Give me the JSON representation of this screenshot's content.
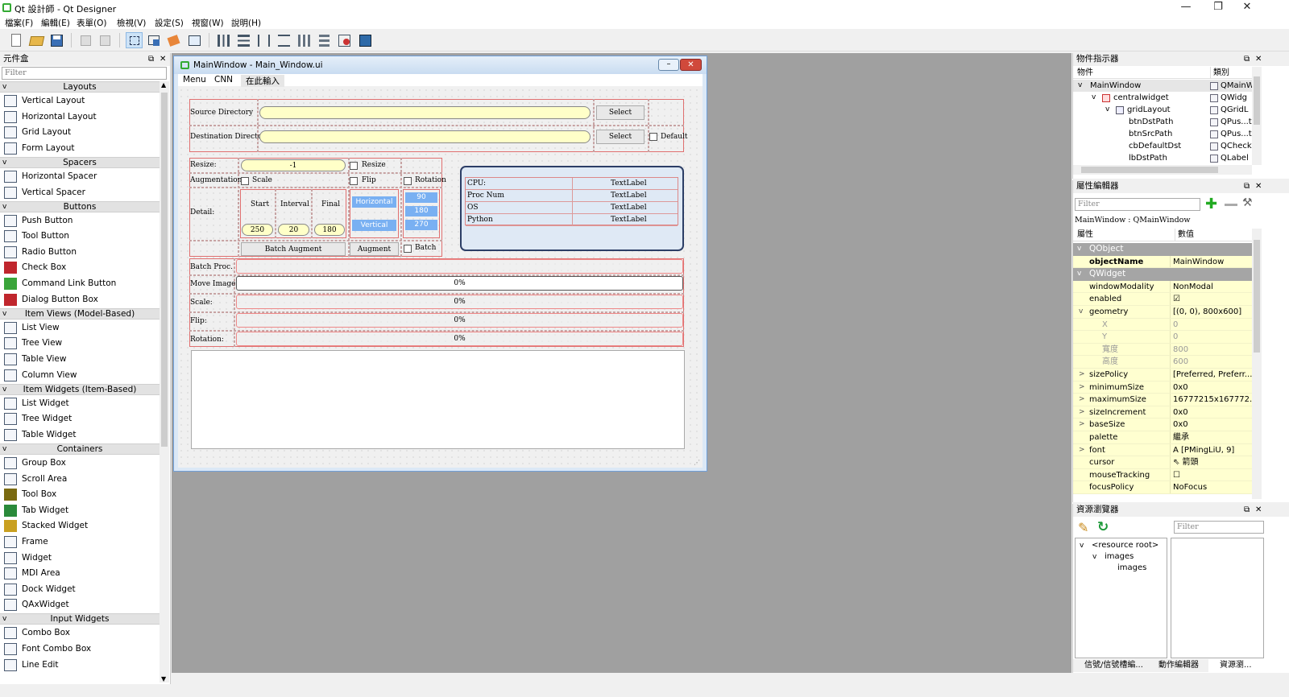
{
  "window": {
    "title": "Qt 設計師 - Qt Designer",
    "minimize": "—",
    "maximize": "❐",
    "close": "✕"
  },
  "menubar": [
    "檔案(F)",
    "編輯(E)",
    "表單(O)",
    "檢視(V)",
    "設定(S)",
    "視窗(W)",
    "說明(H)"
  ],
  "widget_box": {
    "title": "元件盒",
    "filter_placeholder": "Filter",
    "categories": [
      {
        "name": "Layouts",
        "items": [
          "Vertical Layout",
          "Horizontal Layout",
          "Grid Layout",
          "Form Layout"
        ]
      },
      {
        "name": "Spacers",
        "items": [
          "Horizontal Spacer",
          "Vertical Spacer"
        ]
      },
      {
        "name": "Buttons",
        "items": [
          "Push Button",
          "Tool Button",
          "Radio Button",
          "Check Box",
          "Command Link Button",
          "Dialog Button Box"
        ]
      },
      {
        "name": "Item Views (Model-Based)",
        "items": [
          "List View",
          "Tree View",
          "Table View",
          "Column View"
        ]
      },
      {
        "name": "Item Widgets (Item-Based)",
        "items": [
          "List Widget",
          "Tree Widget",
          "Table Widget"
        ]
      },
      {
        "name": "Containers",
        "items": [
          "Group Box",
          "Scroll Area",
          "Tool Box",
          "Tab Widget",
          "Stacked Widget",
          "Frame",
          "Widget",
          "MDI Area",
          "Dock Widget",
          "QAxWidget"
        ]
      },
      {
        "name": "Input Widgets",
        "items": [
          "Combo Box",
          "Font Combo Box",
          "Line Edit"
        ]
      }
    ]
  },
  "form": {
    "title": "MainWindow - Main_Window.ui",
    "menu": [
      "Menu",
      "CNN",
      "在此輸入"
    ],
    "source_label": "Source Directory",
    "dest_label": "Destination Directory",
    "select1": "Select",
    "select2": "Select",
    "default_label": "Default",
    "resize_label": "Resize:",
    "resize_value": "-1",
    "resize_chk": "Resize",
    "aug_label": "Augmentation:",
    "scale_chk": "Scale",
    "flip_chk": "Flip",
    "rotation_chk": "Rotation",
    "detail_label": "Detail:",
    "start_label": "Start",
    "interval_label": "Interval",
    "final_label": "Final",
    "start_value": "250",
    "interval_value": "20",
    "final_value": "180",
    "horizontal": "Horizontal",
    "vertical": "Vertical",
    "r90": "90",
    "r180": "180",
    "r270": "270",
    "batch_augment": "Batch Augment",
    "augment": "Augment",
    "batch_chk": "Batch",
    "info_rows": [
      {
        "k": "CPU:",
        "v": "TextLabel"
      },
      {
        "k": "Proc Num",
        "v": "TextLabel"
      },
      {
        "k": "OS",
        "v": "TextLabel"
      },
      {
        "k": "Python",
        "v": "TextLabel"
      }
    ],
    "progress": [
      {
        "label": "Batch Proc.",
        "text": "",
        "value": 0
      },
      {
        "label": "Move Image:",
        "text": "0%",
        "value": 0
      },
      {
        "label": "Scale:",
        "text": "0%",
        "value": 0
      },
      {
        "label": "Flip:",
        "text": "0%",
        "value": 0
      },
      {
        "label": "Rotation:",
        "text": "0%",
        "value": 0
      }
    ]
  },
  "object_inspector": {
    "title": "物件指示器",
    "col_object": "物件",
    "col_class": "類別",
    "rows": [
      {
        "name": "MainWindow",
        "cls": "QMainWind",
        "depth": 0,
        "expand": "v"
      },
      {
        "name": "centralwidget",
        "cls": "QWidg",
        "depth": 1,
        "expand": "v"
      },
      {
        "name": "gridLayout",
        "cls": "QGridL",
        "depth": 2,
        "expand": "v"
      },
      {
        "name": "btnDstPath",
        "cls": "QPus...t",
        "depth": 3,
        "expand": ""
      },
      {
        "name": "btnSrcPath",
        "cls": "QPus...t",
        "depth": 3,
        "expand": ""
      },
      {
        "name": "cbDefaultDst",
        "cls": "QCheck",
        "depth": 3,
        "expand": ""
      },
      {
        "name": "lbDstPath",
        "cls": "QLabel",
        "depth": 3,
        "expand": ""
      }
    ]
  },
  "property_editor": {
    "title": "屬性編輯器",
    "filter_placeholder": "Filter",
    "context": "MainWindow : QMainWindow",
    "col_prop": "屬性",
    "col_value": "數值",
    "rows": [
      {
        "type": "group",
        "k": "QObject"
      },
      {
        "type": "prop",
        "k": "objectName",
        "v": "MainWindow",
        "exp": "",
        "bold": true
      },
      {
        "type": "group",
        "k": "QWidget"
      },
      {
        "type": "prop",
        "k": "windowModality",
        "v": "NonModal",
        "exp": ""
      },
      {
        "type": "prop",
        "k": "enabled",
        "v": "☑",
        "exp": ""
      },
      {
        "type": "prop",
        "k": "geometry",
        "v": "[(0, 0), 800x600]",
        "exp": "v"
      },
      {
        "type": "sub",
        "k": "X",
        "v": "0"
      },
      {
        "type": "sub",
        "k": "Y",
        "v": "0"
      },
      {
        "type": "sub",
        "k": "寬度",
        "v": "800"
      },
      {
        "type": "sub",
        "k": "高度",
        "v": "600"
      },
      {
        "type": "prop",
        "k": "sizePolicy",
        "v": "[Preferred, Preferr...",
        "exp": ">"
      },
      {
        "type": "prop",
        "k": "minimumSize",
        "v": "0x0",
        "exp": ">"
      },
      {
        "type": "prop",
        "k": "maximumSize",
        "v": "16777215x167772...",
        "exp": ">"
      },
      {
        "type": "prop",
        "k": "sizeIncrement",
        "v": "0x0",
        "exp": ">"
      },
      {
        "type": "prop",
        "k": "baseSize",
        "v": "0x0",
        "exp": ">"
      },
      {
        "type": "prop",
        "k": "palette",
        "v": "繼承",
        "exp": ""
      },
      {
        "type": "prop",
        "k": "font",
        "v": "A  [PMingLiU, 9]",
        "exp": ">"
      },
      {
        "type": "prop",
        "k": "cursor",
        "v": "⇖ 箭頭",
        "exp": ""
      },
      {
        "type": "prop",
        "k": "mouseTracking",
        "v": "☐",
        "exp": ""
      },
      {
        "type": "prop",
        "k": "focusPolicy",
        "v": "NoFocus",
        "exp": ""
      }
    ]
  },
  "resource_browser": {
    "title": "資源瀏覽器",
    "filter_placeholder": "Filter",
    "tree": [
      {
        "name": "<resource root>",
        "depth": 0,
        "expand": "v"
      },
      {
        "name": "images",
        "depth": 1,
        "expand": "v"
      },
      {
        "name": "images",
        "depth": 2,
        "expand": ""
      }
    ],
    "tabs": [
      "信號/信號槽編...",
      "動作編輯器",
      "資源瀏..."
    ]
  },
  "colors": {
    "accent_yellow": "#ffffd0",
    "group_gray": "#a5a5a5",
    "pill_yellow": "#ffffc8",
    "layout_red": "#e07070",
    "mdi_blue": "#6f9fd8"
  }
}
